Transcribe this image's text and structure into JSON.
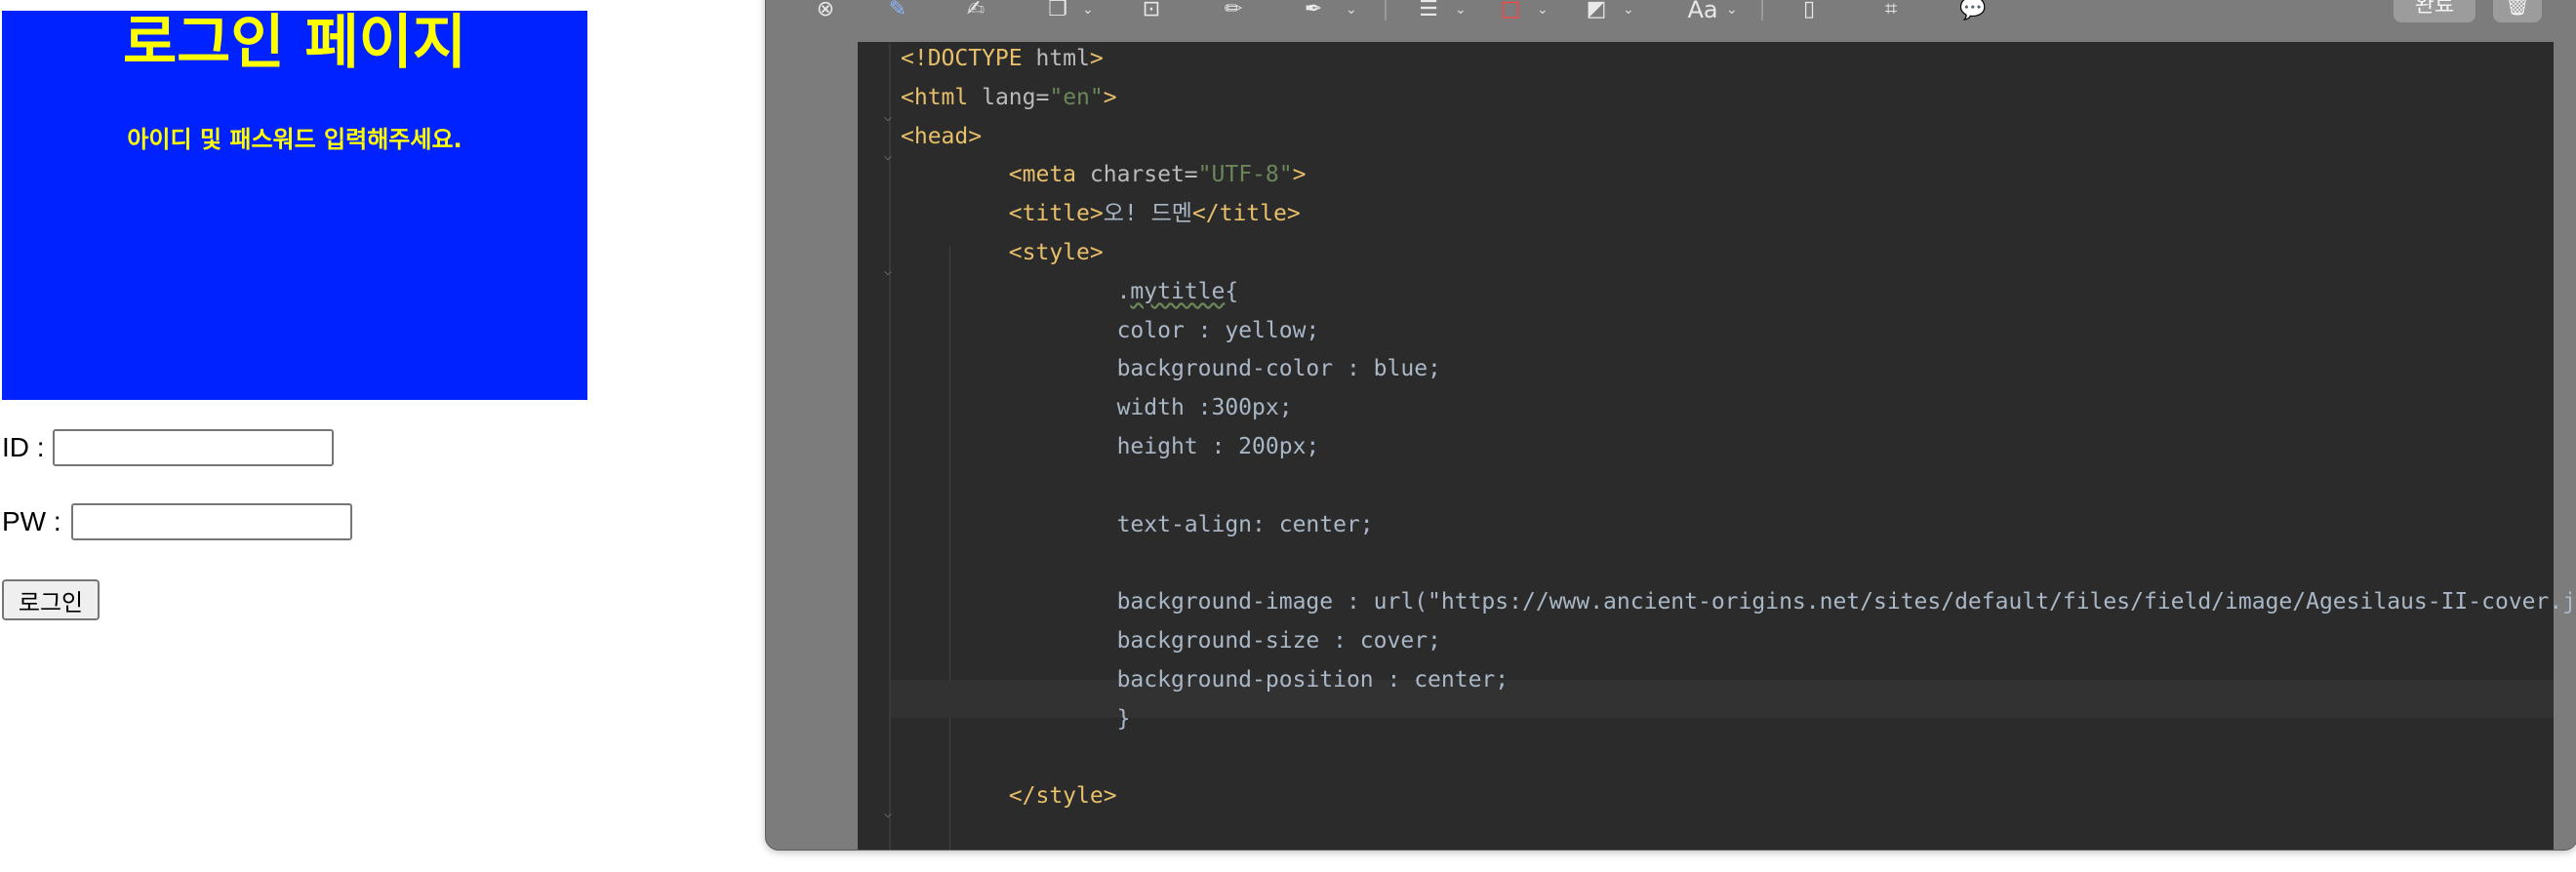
{
  "login_page": {
    "title": "로그인 페이지",
    "subtitle": "아이디 및 패스워드 입력해주세요.",
    "id_label": "ID :",
    "pw_label": "PW :",
    "id_value": "",
    "pw_value": "",
    "login_button": "로그인",
    "box_bg": "#0022ff",
    "box_text_color": "#ffff00"
  },
  "editor": {
    "toolbar": {
      "done_button": "완료",
      "text_style_label": "Aa",
      "icons": [
        "close-icon",
        "pen-icon",
        "scribble-icon",
        "shapes-icon",
        "text-box-icon",
        "highlight-icon",
        "signature-icon",
        "line-style-icon",
        "border-color-icon",
        "fill-color-icon",
        "font-icon",
        "rotate-icon",
        "crop-icon",
        "comment-icon",
        "trash-icon"
      ]
    },
    "code_lines": [
      {
        "indent": "",
        "parts": [
          {
            "t": "tag",
            "v": "<!DOCTYPE "
          },
          {
            "t": "attr",
            "v": "html"
          },
          {
            "t": "tag",
            "v": ">"
          }
        ]
      },
      {
        "indent": "",
        "parts": [
          {
            "t": "tag",
            "v": "<html "
          },
          {
            "t": "attr",
            "v": "lang="
          },
          {
            "t": "str",
            "v": "\"en\""
          },
          {
            "t": "tag",
            "v": ">"
          }
        ]
      },
      {
        "indent": "",
        "parts": [
          {
            "t": "tag",
            "v": "<head>"
          }
        ]
      },
      {
        "indent": "    ",
        "parts": [
          {
            "t": "tag",
            "v": "<meta "
          },
          {
            "t": "attr",
            "v": "charset="
          },
          {
            "t": "str",
            "v": "\"UTF-8\""
          },
          {
            "t": "tag",
            "v": ">"
          }
        ]
      },
      {
        "indent": "    ",
        "parts": [
          {
            "t": "tag",
            "v": "<title>"
          },
          {
            "t": "plain",
            "v": "오! 드멘"
          },
          {
            "t": "tag",
            "v": "</title>"
          }
        ]
      },
      {
        "indent": "    ",
        "parts": [
          {
            "t": "tag",
            "v": "<style>"
          }
        ]
      },
      {
        "indent": "        ",
        "parts": [
          {
            "t": "plain",
            "v": "."
          },
          {
            "t": "wavy",
            "v": "mytitle"
          },
          {
            "t": "plain",
            "v": "{"
          }
        ]
      },
      {
        "indent": "        ",
        "parts": [
          {
            "t": "plain",
            "v": "color : yellow;"
          }
        ]
      },
      {
        "indent": "        ",
        "parts": [
          {
            "t": "plain",
            "v": "background-color : blue;"
          }
        ]
      },
      {
        "indent": "        ",
        "parts": [
          {
            "t": "plain",
            "v": "width :300px;"
          }
        ]
      },
      {
        "indent": "        ",
        "parts": [
          {
            "t": "plain",
            "v": "height : 200px;"
          }
        ]
      },
      {
        "indent": "",
        "parts": []
      },
      {
        "indent": "        ",
        "parts": [
          {
            "t": "plain",
            "v": "text-align: center;"
          }
        ]
      },
      {
        "indent": "",
        "parts": []
      },
      {
        "indent": "        ",
        "parts": [
          {
            "t": "plain",
            "v": "background-image : url(\"https://www.ancient-origins.net/sites/default/files/field/image/Agesilaus-II-cover.jpg\");"
          }
        ]
      },
      {
        "indent": "        ",
        "parts": [
          {
            "t": "plain",
            "v": "background-size : cover;"
          }
        ]
      },
      {
        "indent": "        ",
        "parts": [
          {
            "t": "plain",
            "v": "background-position : center;"
          }
        ]
      },
      {
        "indent": "        ",
        "parts": [
          {
            "t": "plain",
            "v": "}"
          }
        ]
      },
      {
        "indent": "",
        "parts": []
      },
      {
        "indent": "    ",
        "parts": [
          {
            "t": "tag",
            "v": "</style>"
          }
        ]
      }
    ]
  }
}
